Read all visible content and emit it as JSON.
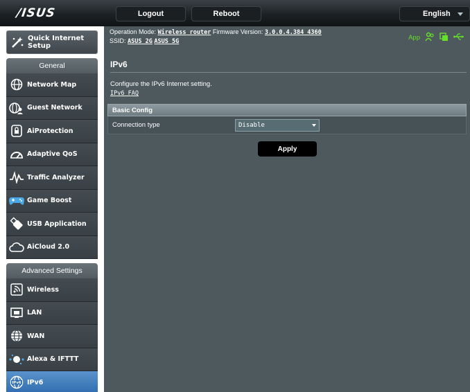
{
  "header": {
    "logo_text": "/ISUS",
    "logout_label": "Logout",
    "reboot_label": "Reboot",
    "language": "English"
  },
  "status_bar": {
    "operation_mode_label": "Operation Mode:",
    "operation_mode_value": "Wireless router",
    "firmware_label": "Firmware Version:",
    "firmware_value": "3.0.0.4.384_4360",
    "ssid_label": "SSID:",
    "ssid_2g": "ASUS_2G",
    "ssid_5g": "ASUS_5G",
    "app_label": "App",
    "icon_color": "#66e02a"
  },
  "sidebar": {
    "quick_setup_label": "Quick Internet Setup",
    "general_heading": "General",
    "general_items": [
      {
        "label": "Network Map",
        "icon": "network-map-icon"
      },
      {
        "label": "Guest Network",
        "icon": "guest-network-icon"
      },
      {
        "label": "AiProtection",
        "icon": "aiprotection-icon"
      },
      {
        "label": "Adaptive QoS",
        "icon": "adaptive-qos-icon"
      },
      {
        "label": "Traffic Analyzer",
        "icon": "traffic-analyzer-icon"
      },
      {
        "label": "Game Boost",
        "icon": "game-boost-icon"
      },
      {
        "label": "USB Application",
        "icon": "usb-application-icon"
      },
      {
        "label": "AiCloud 2.0",
        "icon": "aicloud-icon"
      }
    ],
    "advanced_heading": "Advanced Settings",
    "advanced_items": [
      {
        "label": "Wireless",
        "icon": "wireless-icon"
      },
      {
        "label": "LAN",
        "icon": "lan-icon"
      },
      {
        "label": "WAN",
        "icon": "wan-icon"
      },
      {
        "label": "Alexa & IFTTT",
        "icon": "alexa-ifttt-icon"
      },
      {
        "label": "IPv6",
        "icon": "ipv6-icon",
        "active": true
      }
    ],
    "active_color": "#3f7fbf"
  },
  "main": {
    "title": "IPv6",
    "description": "Configure the IPv6 Internet setting.",
    "faq_link": "IPv6 FAQ",
    "section_title": "Basic Config",
    "connection_type_label": "Connection type",
    "connection_type_value": "Disable",
    "apply_label": "Apply"
  }
}
